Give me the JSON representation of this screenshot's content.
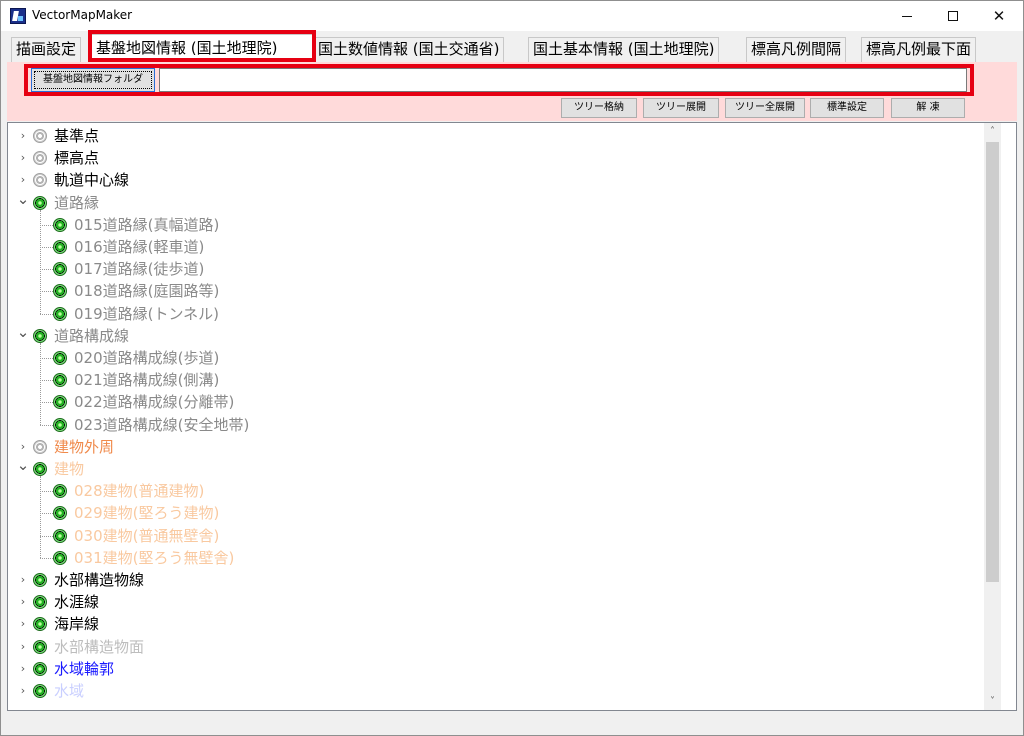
{
  "window": {
    "title": "VectorMapMaker",
    "close_glyph": "✕"
  },
  "tabs": [
    {
      "label": "描画設定"
    },
    {
      "label": "基盤地図情報 (国土地理院)"
    },
    {
      "label": "国土数値情報 (国土交通省)"
    },
    {
      "label": "国土基本情報 (国土地理院)"
    },
    {
      "label": "標高凡例間隔"
    },
    {
      "label": "標高凡例最下面"
    }
  ],
  "active_tab": 1,
  "folder": {
    "button_label": "基盤地図情報フォルダ",
    "path_value": ""
  },
  "toolbar": {
    "collapse": "ツリー格納",
    "expand": "ツリー展開",
    "expand_all": "ツリー全展開",
    "default_settings": "標準設定",
    "thaw": "解 凍"
  },
  "colors": {
    "highlight": "#e60012",
    "panel_bg": "#ffdada",
    "label_black": "#000000",
    "label_gray": "#8a8a8a",
    "label_orange": "#f08a4b",
    "label_light_orange": "#f9c9a0",
    "label_light_gray": "#bdbdbd",
    "label_blue": "#1a1aff",
    "label_faint_blue": "#c9cfff"
  },
  "tree": [
    {
      "label": "基準点",
      "level": 0,
      "expander": "right",
      "icon": "gray",
      "color": "#000000"
    },
    {
      "label": "標高点",
      "level": 0,
      "expander": "right",
      "icon": "gray",
      "color": "#000000"
    },
    {
      "label": "軌道中心線",
      "level": 0,
      "expander": "right",
      "icon": "gray",
      "color": "#000000"
    },
    {
      "label": "道路縁",
      "level": 0,
      "expander": "down",
      "icon": "green",
      "color": "#8a8a8a"
    },
    {
      "label": "015道路縁(真幅道路)",
      "level": 1,
      "icon": "green",
      "color": "#8a8a8a"
    },
    {
      "label": "016道路縁(軽車道)",
      "level": 1,
      "icon": "green",
      "color": "#8a8a8a"
    },
    {
      "label": "017道路縁(徒歩道)",
      "level": 1,
      "icon": "green",
      "color": "#8a8a8a"
    },
    {
      "label": "018道路縁(庭園路等)",
      "level": 1,
      "icon": "green",
      "color": "#8a8a8a"
    },
    {
      "label": "019道路縁(トンネル)",
      "level": 1,
      "icon": "green",
      "color": "#8a8a8a"
    },
    {
      "label": "道路構成線",
      "level": 0,
      "expander": "down",
      "icon": "green",
      "color": "#8a8a8a"
    },
    {
      "label": "020道路構成線(歩道)",
      "level": 1,
      "icon": "green",
      "color": "#8a8a8a"
    },
    {
      "label": "021道路構成線(側溝)",
      "level": 1,
      "icon": "green",
      "color": "#8a8a8a"
    },
    {
      "label": "022道路構成線(分離帯)",
      "level": 1,
      "icon": "green",
      "color": "#8a8a8a"
    },
    {
      "label": "023道路構成線(安全地帯)",
      "level": 1,
      "icon": "green",
      "color": "#8a8a8a"
    },
    {
      "label": "建物外周",
      "level": 0,
      "expander": "right",
      "icon": "gray",
      "color": "#f08a4b"
    },
    {
      "label": "建物",
      "level": 0,
      "expander": "down",
      "icon": "green",
      "color": "#f9c9a0"
    },
    {
      "label": "028建物(普通建物)",
      "level": 1,
      "icon": "green",
      "color": "#f9c9a0"
    },
    {
      "label": "029建物(堅ろう建物)",
      "level": 1,
      "icon": "green",
      "color": "#f9c9a0"
    },
    {
      "label": "030建物(普通無壁舎)",
      "level": 1,
      "icon": "green",
      "color": "#f9c9a0"
    },
    {
      "label": "031建物(堅ろう無壁舎)",
      "level": 1,
      "icon": "green",
      "color": "#f9c9a0"
    },
    {
      "label": "水部構造物線",
      "level": 0,
      "expander": "right",
      "icon": "green",
      "color": "#000000"
    },
    {
      "label": "水涯線",
      "level": 0,
      "expander": "right",
      "icon": "green",
      "color": "#000000"
    },
    {
      "label": "海岸線",
      "level": 0,
      "expander": "right",
      "icon": "green",
      "color": "#000000"
    },
    {
      "label": "水部構造物面",
      "level": 0,
      "expander": "right",
      "icon": "green",
      "color": "#bdbdbd"
    },
    {
      "label": "水域輪郭",
      "level": 0,
      "expander": "right",
      "icon": "green",
      "color": "#1a1aff"
    },
    {
      "label": "水域",
      "level": 0,
      "expander": "right",
      "icon": "green",
      "color": "#c9cfff"
    }
  ],
  "scrollbar": {
    "up_glyph": "˄",
    "down_glyph": "˅"
  }
}
